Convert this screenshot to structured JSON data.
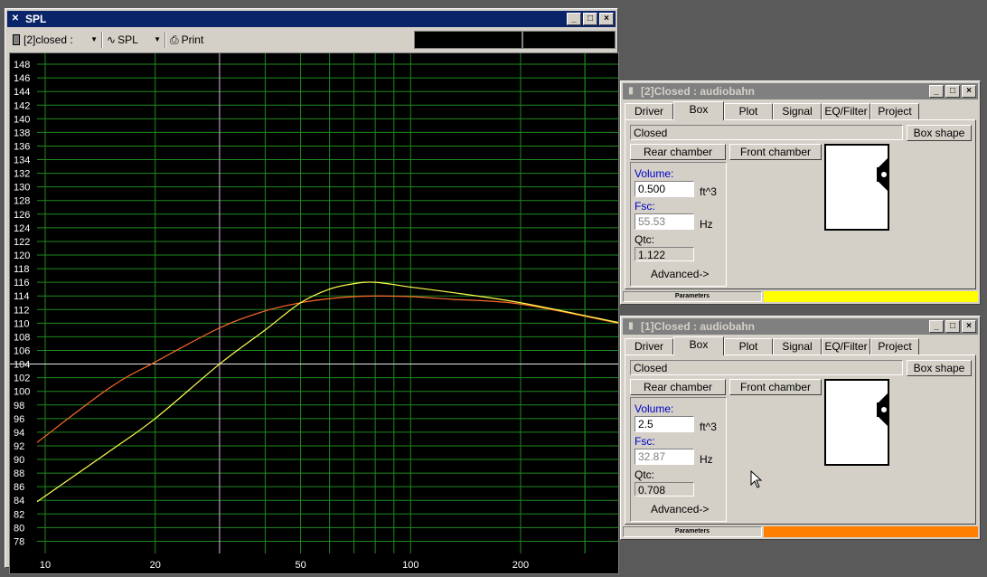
{
  "spl_window": {
    "title": "SPL",
    "toolbar": {
      "driver_select": "[2]closed :",
      "graph_select": "SPL",
      "print_label": "Print"
    },
    "y_tick_labels": [
      "148",
      "146",
      "144",
      "142",
      "140",
      "138",
      "136",
      "134",
      "132",
      "130",
      "128",
      "126",
      "124",
      "122",
      "120",
      "118",
      "116",
      "114",
      "112",
      "110",
      "108",
      "106",
      "104",
      "102",
      "100",
      "98",
      "96",
      "94",
      "92",
      "90",
      "88",
      "86",
      "84",
      "82",
      "80",
      "78"
    ],
    "x_tick_labels": [
      "10",
      "20",
      "50",
      "100",
      "200"
    ],
    "cursor_freq_hz": 30,
    "reference_level_db": 104
  },
  "chart_data": {
    "type": "line",
    "x_scale": "log",
    "xlim": [
      9.5,
      370
    ],
    "ylim": [
      76.2,
      149.6
    ],
    "grid": true,
    "x_ticks": [
      10,
      20,
      50,
      100,
      200
    ],
    "y_ticks": [
      148,
      146,
      144,
      142,
      140,
      138,
      136,
      134,
      132,
      130,
      128,
      126,
      124,
      122,
      120,
      118,
      116,
      114,
      112,
      110,
      108,
      106,
      104,
      102,
      100,
      98,
      96,
      94,
      92,
      90,
      88,
      86,
      84,
      82,
      80,
      78
    ],
    "series": [
      {
        "color": "#ff6a2a",
        "x": [
          9.5,
          15,
          20,
          30,
          40,
          50,
          60,
          70,
          80,
          100,
          130,
          200,
          370
        ],
        "y": [
          92.5,
          100.5,
          104.3,
          109.3,
          111.8,
          113.0,
          113.6,
          113.9,
          114.0,
          113.9,
          113.5,
          112.8,
          110.0
        ]
      },
      {
        "color": "#ffff50",
        "x": [
          9.5,
          15,
          20,
          30,
          40,
          50,
          60,
          70,
          80,
          100,
          130,
          200,
          370
        ],
        "y": [
          83.8,
          91.2,
          96.0,
          104.0,
          109.0,
          113.0,
          115.0,
          115.8,
          116.0,
          115.3,
          114.5,
          113.0,
          110.1
        ]
      }
    ]
  },
  "box_windows": [
    {
      "title": "[2]Closed : audiobahn",
      "tabs": [
        "Driver",
        "Box",
        "Plot",
        "Signal",
        "EQ/Filter",
        "Project"
      ],
      "box_type": "Closed",
      "box_shape_button": "Box shape",
      "rear_chamber_button": "Rear chamber",
      "front_chamber_button": "Front chamber",
      "volume_label": "Volume:",
      "volume_value": "0.500",
      "volume_unit": "ft^3",
      "fsc_label": "Fsc:",
      "fsc_value": "55.53",
      "fsc_unit": "Hz",
      "qtc_label": "Qtc:",
      "qtc_value": "1.122",
      "advanced_button": "Advanced->",
      "status_label": "Parameters",
      "status_color": "#ffff00"
    },
    {
      "title": "[1]Closed : audiobahn",
      "tabs": [
        "Driver",
        "Box",
        "Plot",
        "Signal",
        "EQ/Filter",
        "Project"
      ],
      "box_type": "Closed",
      "box_shape_button": "Box shape",
      "rear_chamber_button": "Rear chamber",
      "front_chamber_button": "Front chamber",
      "volume_label": "Volume:",
      "volume_value": "2.5",
      "volume_unit": "ft^3",
      "fsc_label": "Fsc:",
      "fsc_value": "32.87",
      "fsc_unit": "Hz",
      "qtc_label": "Qtc:",
      "qtc_value": "0.708",
      "advanced_button": "Advanced->",
      "status_label": "Parameters",
      "status_color": "#ff8000"
    }
  ]
}
